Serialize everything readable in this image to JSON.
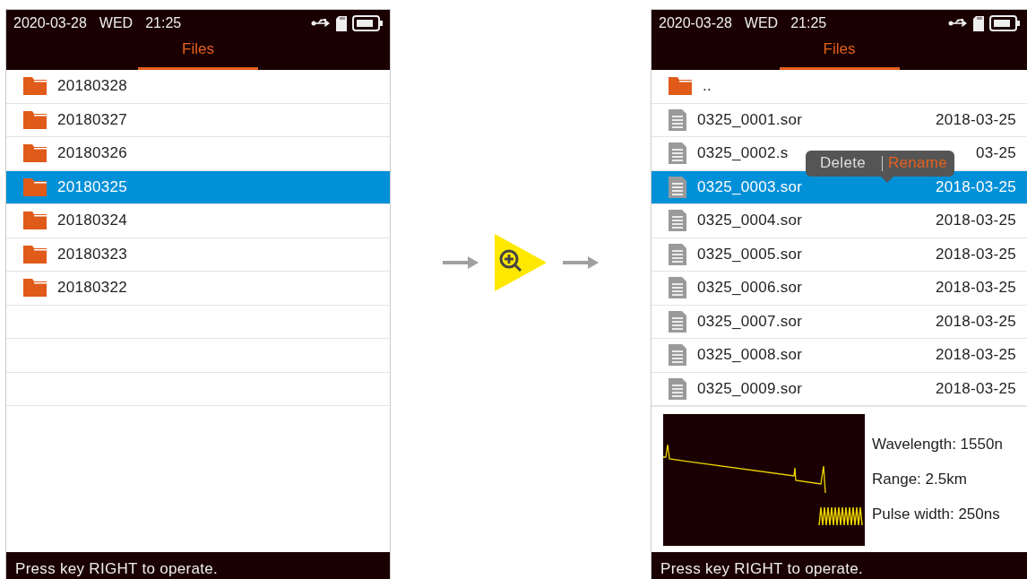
{
  "screens": [
    {
      "status": {
        "date": "2020-03-28",
        "weekday": "WED",
        "time": "21:25"
      },
      "tab": {
        "label": "Files",
        "selected": true
      },
      "rows": [
        {
          "kind": "folder",
          "name": "20180328",
          "selected": false
        },
        {
          "kind": "folder",
          "name": "20180327",
          "selected": false
        },
        {
          "kind": "folder",
          "name": "20180326",
          "selected": false
        },
        {
          "kind": "folder",
          "name": "20180325",
          "selected": true
        },
        {
          "kind": "folder",
          "name": "20180324",
          "selected": false
        },
        {
          "kind": "folder",
          "name": "20180323",
          "selected": false
        },
        {
          "kind": "folder",
          "name": "20180322",
          "selected": false
        },
        {
          "kind": "empty"
        },
        {
          "kind": "empty"
        },
        {
          "kind": "empty"
        }
      ],
      "footer": "Press key RIGHT to operate."
    },
    {
      "status": {
        "date": "2020-03-28",
        "weekday": "WED",
        "time": "21:25"
      },
      "tab": {
        "label": "Files",
        "selected": true
      },
      "rows": [
        {
          "kind": "folder",
          "name": "..",
          "selected": false
        },
        {
          "kind": "file",
          "name": "0325_0001.sor",
          "date": "2018-03-25",
          "selected": false
        },
        {
          "kind": "file",
          "name": "0325_0002.s",
          "date": "03-25",
          "selected": false
        },
        {
          "kind": "file",
          "name": "0325_0003.sor",
          "date": "2018-03-25",
          "selected": true,
          "menu": [
            {
              "label": "Delete",
              "selected": false
            },
            {
              "label": "Rename",
              "selected": true
            }
          ]
        },
        {
          "kind": "file",
          "name": "0325_0004.sor",
          "date": "2018-03-25",
          "selected": false
        },
        {
          "kind": "file",
          "name": "0325_0005.sor",
          "date": "2018-03-25",
          "selected": false
        },
        {
          "kind": "file",
          "name": "0325_0006.sor",
          "date": "2018-03-25",
          "selected": false
        },
        {
          "kind": "file",
          "name": "0325_0007.sor",
          "date": "2018-03-25",
          "selected": false
        },
        {
          "kind": "file",
          "name": "0325_0008.sor",
          "date": "2018-03-25",
          "selected": false
        },
        {
          "kind": "file",
          "name": "0325_0009.sor",
          "date": "2018-03-25",
          "selected": false
        }
      ],
      "preview": {
        "info": [
          "Wavelength: 1550n",
          "Range: 2.5km",
          "Pulse width: 250ns"
        ]
      },
      "footer": "Press key RIGHT to operate."
    }
  ]
}
